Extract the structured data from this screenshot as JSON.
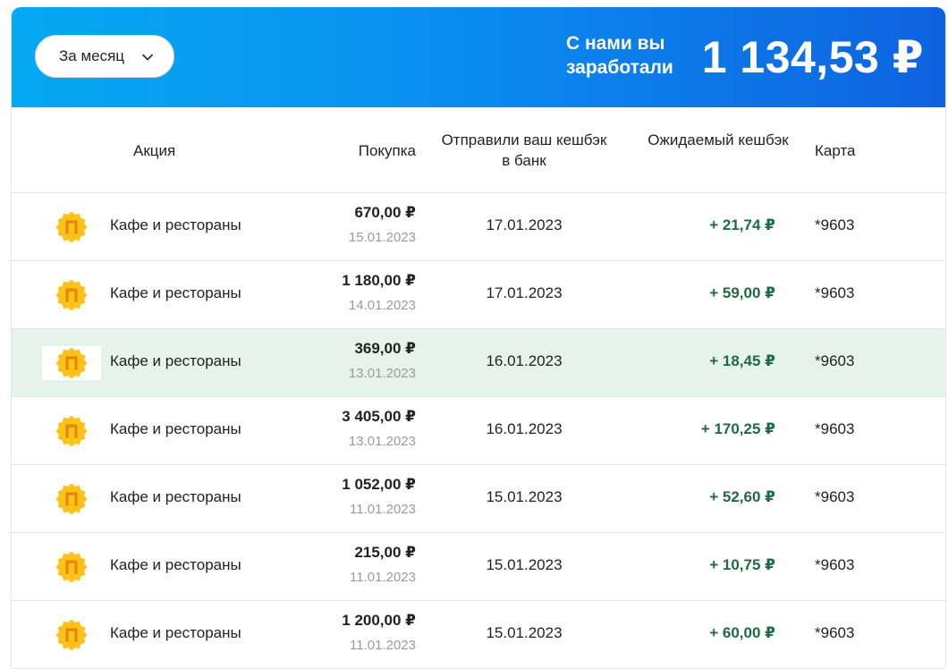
{
  "header": {
    "period_label": "За месяц",
    "earned_label": "С нами вы заработали",
    "earned_amount": "1 134,53 ₽"
  },
  "columns": {
    "promo": "Акция",
    "purchase": "Покупка",
    "sent": "Отправили ваш кешбэк в банк",
    "expected": "Ожидаемый кешбэк",
    "card": "Карта"
  },
  "colors": {
    "header_gradient_start": "#06a9f2",
    "header_gradient_end": "#0f62e0",
    "cashback_green": "#1f6b44",
    "highlight_row": "#e6f3ec",
    "logo_yellow": "#ffc21a",
    "logo_orange": "#e58a00"
  },
  "rows": [
    {
      "logo_icon": "pyaterochka-logo-icon",
      "promo": "Кафе и рестораны",
      "amount": "670,00 ₽",
      "purchase_date": "15.01.2023",
      "sent_date": "17.01.2023",
      "cashback": "+ 21,74 ₽",
      "card": "*9603"
    },
    {
      "logo_icon": "pyaterochka-logo-icon",
      "promo": "Кафе и рестораны",
      "amount": "1 180,00 ₽",
      "purchase_date": "14.01.2023",
      "sent_date": "17.01.2023",
      "cashback": "+ 59,00 ₽",
      "card": "*9603"
    },
    {
      "logo_icon": "pyaterochka-logo-icon",
      "promo": "Кафе и рестораны",
      "amount": "369,00 ₽",
      "purchase_date": "13.01.2023",
      "sent_date": "16.01.2023",
      "cashback": "+ 18,45 ₽",
      "card": "*9603"
    },
    {
      "logo_icon": "pyaterochka-logo-icon",
      "promo": "Кафе и рестораны",
      "amount": "3 405,00 ₽",
      "purchase_date": "13.01.2023",
      "sent_date": "16.01.2023",
      "cashback": "+ 170,25 ₽",
      "card": "*9603"
    },
    {
      "logo_icon": "pyaterochka-logo-icon",
      "promo": "Кафе и рестораны",
      "amount": "1 052,00 ₽",
      "purchase_date": "11.01.2023",
      "sent_date": "15.01.2023",
      "cashback": "+ 52,60 ₽",
      "card": "*9603"
    },
    {
      "logo_icon": "pyaterochka-logo-icon",
      "promo": "Кафе и рестораны",
      "amount": "215,00 ₽",
      "purchase_date": "11.01.2023",
      "sent_date": "15.01.2023",
      "cashback": "+ 10,75 ₽",
      "card": "*9603"
    },
    {
      "logo_icon": "pyaterochka-logo-icon",
      "promo": "Кафе и рестораны",
      "amount": "1 200,00 ₽",
      "purchase_date": "11.01.2023",
      "sent_date": "15.01.2023",
      "cashback": "+ 60,00 ₽",
      "card": "*9603"
    }
  ]
}
